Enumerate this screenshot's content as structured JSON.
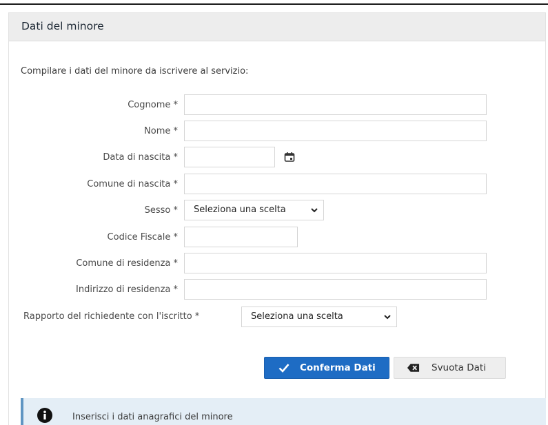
{
  "panel": {
    "title": "Dati del minore"
  },
  "intro": "Compilare i dati del minore da iscrivere al servizio:",
  "fields": {
    "cognome": {
      "label": "Cognome *",
      "value": ""
    },
    "nome": {
      "label": "Nome *",
      "value": ""
    },
    "data_nascita": {
      "label": "Data di nascita *",
      "value": ""
    },
    "comune_nascita": {
      "label": "Comune di nascita *",
      "value": ""
    },
    "sesso": {
      "label": "Sesso *",
      "value": "Seleziona una scelta"
    },
    "codice_fiscale": {
      "label": "Codice Fiscale *",
      "value": ""
    },
    "comune_residenza": {
      "label": "Comune di residenza *",
      "value": ""
    },
    "indirizzo_residenza": {
      "label": "Indirizzo di residenza *",
      "value": ""
    },
    "rapporto": {
      "label": "Rapporto del richiedente con l'iscritto *",
      "value": "Seleziona una scelta"
    }
  },
  "buttons": {
    "confirm": "Conferma Dati",
    "clear": "Svuota Dati"
  },
  "info": {
    "text": "Inserisci i dati anagrafici del minore"
  },
  "icons": {
    "calendar": "calendar-icon",
    "chevron": "chevron-down-icon",
    "check": "check-icon",
    "backspace": "backspace-icon",
    "info": "info-icon"
  },
  "colors": {
    "primary": "#1e6cc4",
    "header_bg": "#ededed",
    "info_bg": "#e4eef6",
    "info_border": "#5f95c2"
  }
}
